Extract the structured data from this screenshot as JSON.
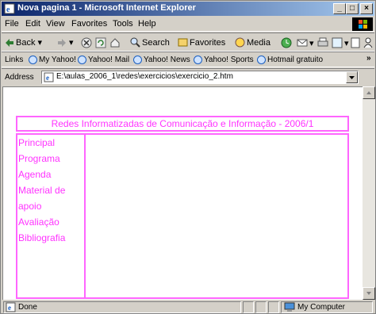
{
  "window": {
    "title": "Nova pagina 1 - Microsoft Internet Explorer"
  },
  "caption_buttons": {
    "minimize": "_",
    "maximize": "□",
    "close": "×"
  },
  "menu": [
    "File",
    "Edit",
    "View",
    "Favorites",
    "Tools",
    "Help"
  ],
  "toolbar": {
    "back": "Back",
    "search": "Search",
    "favorites": "Favorites",
    "media": "Media"
  },
  "links": {
    "label": "Links",
    "items": [
      "My Yahoo!",
      "Yahoo! Mail",
      "Yahoo! News",
      "Yahoo! Sports",
      "Hotmail gratuito"
    ],
    "more": "»"
  },
  "address": {
    "label": "Address",
    "value": "E:\\aulas_2006_1\\redes\\exercicios\\exercicio_2.htm"
  },
  "page": {
    "header": "Redes Informatizadas de Comunicação e Informação - 2006/1",
    "nav": [
      "Principal",
      "Programa",
      "Agenda",
      "Material de apoio",
      "Avaliação",
      "Bibliografia"
    ]
  },
  "status": {
    "text": "Done",
    "zone": "My Computer"
  },
  "colors": {
    "page_accent": "#ff33ff",
    "titlebar_start": "#0a246a",
    "titlebar_end": "#a6caf0"
  }
}
